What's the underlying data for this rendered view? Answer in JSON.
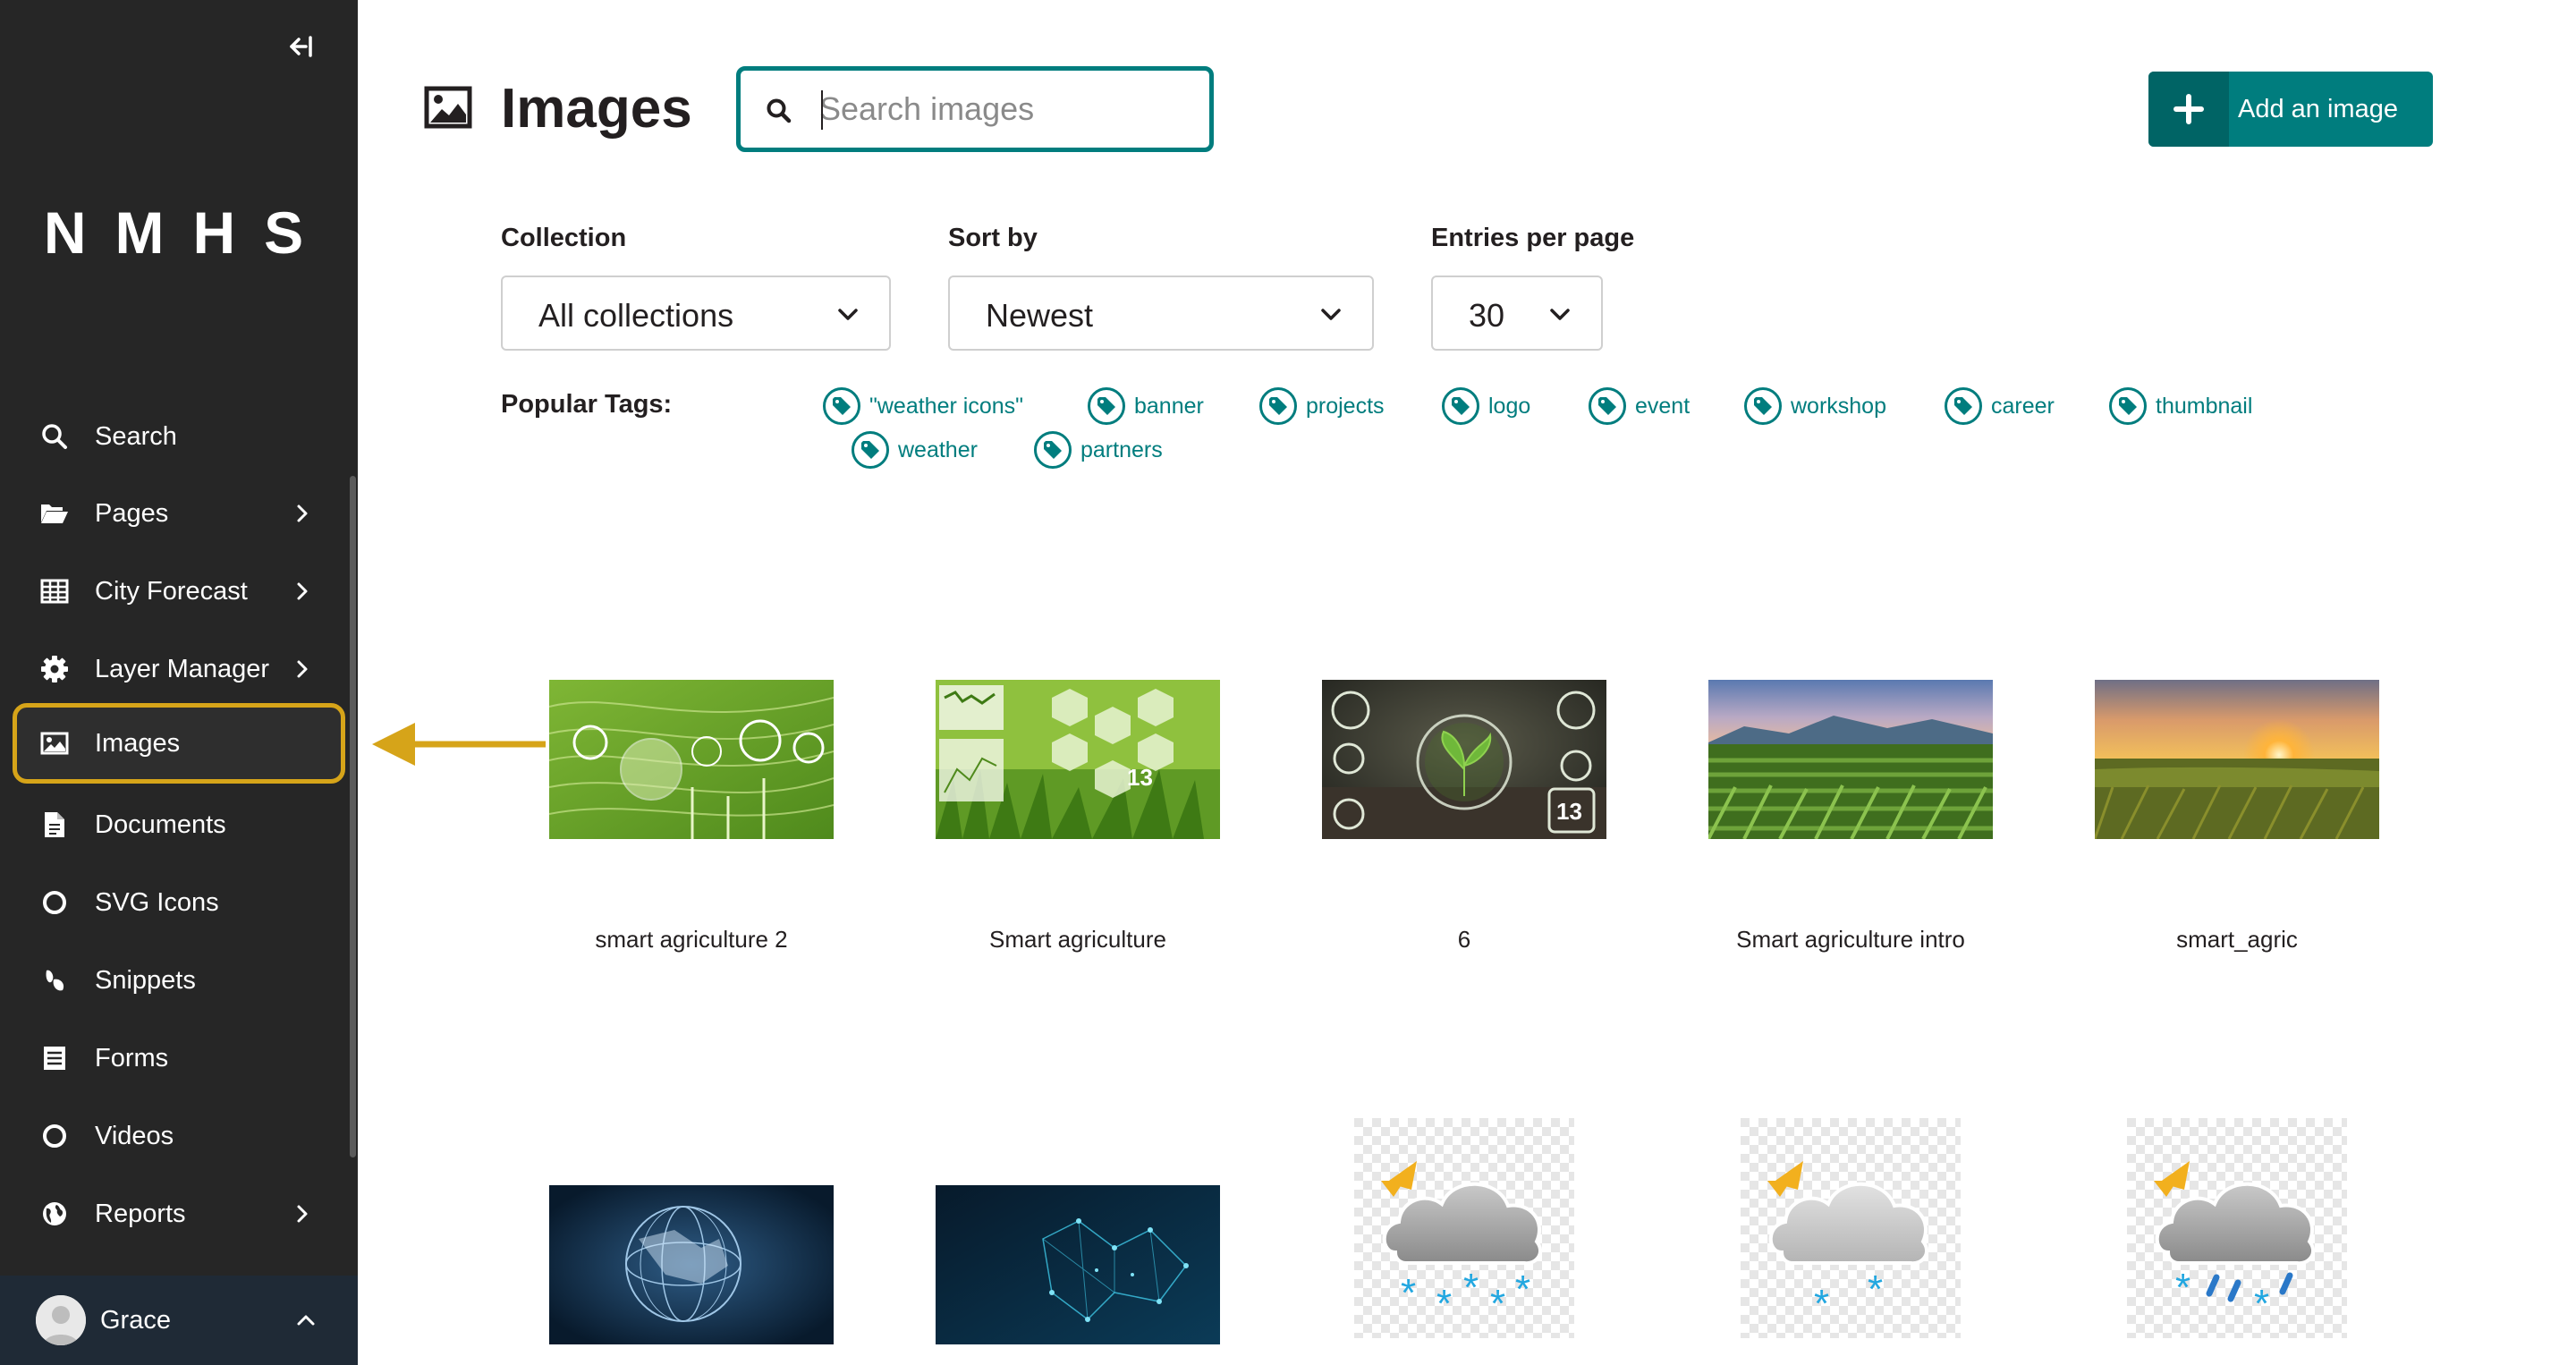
{
  "sidebar": {
    "collapse_label": "Collapse sidebar",
    "brand": "NMHS",
    "items": [
      {
        "label": "Search",
        "icon": "search-icon",
        "has_chevron": false
      },
      {
        "label": "Pages",
        "icon": "folder-open-icon",
        "has_chevron": true
      },
      {
        "label": "City Forecast",
        "icon": "table-icon",
        "has_chevron": true
      },
      {
        "label": "Layer Manager",
        "icon": "gear-icon",
        "has_chevron": true
      },
      {
        "label": "Images",
        "icon": "image-icon",
        "has_chevron": false,
        "active": true
      },
      {
        "label": "Documents",
        "icon": "document-icon",
        "has_chevron": false
      },
      {
        "label": "SVG Icons",
        "icon": "circle-icon",
        "has_chevron": false
      },
      {
        "label": "Snippets",
        "icon": "snippet-icon",
        "has_chevron": false
      },
      {
        "label": "Forms",
        "icon": "form-icon",
        "has_chevron": false
      },
      {
        "label": "Videos",
        "icon": "circle-icon",
        "has_chevron": false
      },
      {
        "label": "Reports",
        "icon": "globe-icon",
        "has_chevron": true
      }
    ],
    "user": {
      "name": "Grace"
    }
  },
  "header": {
    "title": "Images",
    "search_placeholder": "Search images",
    "add_button_label": "Add an image"
  },
  "filters": {
    "collection": {
      "label": "Collection",
      "value": "All collections"
    },
    "sort": {
      "label": "Sort by",
      "value": "Newest"
    },
    "per_page": {
      "label": "Entries per page",
      "value": "30"
    }
  },
  "popular_tags": {
    "label": "Popular Tags:",
    "tags": [
      "\"weather icons\"",
      "banner",
      "projects",
      "logo",
      "event",
      "workshop",
      "career",
      "thumbnail",
      "weather",
      "partners"
    ]
  },
  "images": [
    {
      "title": "smart agriculture 2"
    },
    {
      "title": "Smart agriculture"
    },
    {
      "title": "6"
    },
    {
      "title": "Smart agriculture intro"
    },
    {
      "title": "smart_agric"
    },
    {
      "title": ""
    },
    {
      "title": ""
    },
    {
      "title": ""
    },
    {
      "title": ""
    },
    {
      "title": ""
    }
  ],
  "colors": {
    "accent": "#007d7e",
    "sidebar_bg": "#262626",
    "highlight": "#d6a419"
  }
}
